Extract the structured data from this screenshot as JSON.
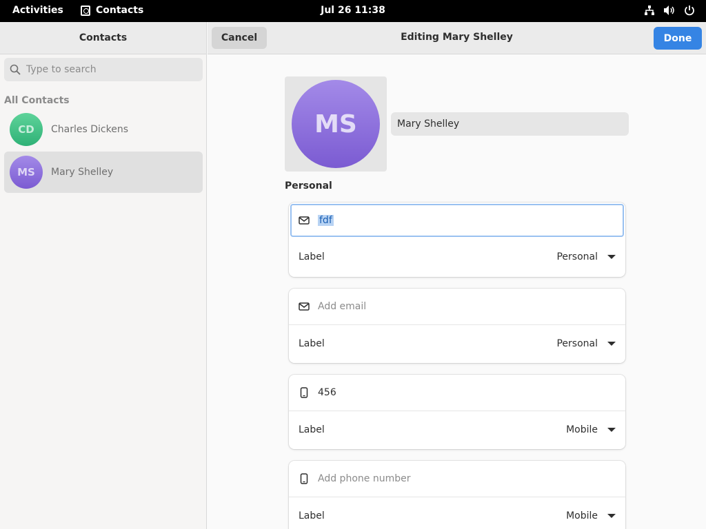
{
  "topbar": {
    "activities": "Activities",
    "app_name": "Contacts",
    "clock": "Jul 26  11:38"
  },
  "sidebar": {
    "title": "Contacts",
    "search_placeholder": "Type to search",
    "group_title": "All Contacts",
    "contacts": [
      {
        "initials": "CD",
        "name": "Charles Dickens"
      },
      {
        "initials": "MS",
        "name": "Mary Shelley"
      }
    ]
  },
  "main": {
    "cancel_label": "Cancel",
    "title": "Editing Mary Shelley",
    "done_label": "Done",
    "avatar_initials": "MS",
    "name_value": "Mary Shelley",
    "section_title": "Personal",
    "fields": [
      {
        "icon": "mail-icon",
        "value": "fdf",
        "placeholder": "",
        "label": "Label",
        "label_value": "Personal"
      },
      {
        "icon": "mail-icon",
        "value": "",
        "placeholder": "Add email",
        "label": "Label",
        "label_value": "Personal"
      },
      {
        "icon": "phone-icon",
        "value": "456",
        "placeholder": "",
        "label": "Label",
        "label_value": "Mobile"
      },
      {
        "icon": "phone-icon",
        "value": "",
        "placeholder": "Add phone number",
        "label": "Label",
        "label_value": "Mobile"
      }
    ]
  },
  "colors": {
    "accent": "#3584e4",
    "avatar_green": "#2fb176",
    "avatar_purple": "#7b5bd2"
  }
}
